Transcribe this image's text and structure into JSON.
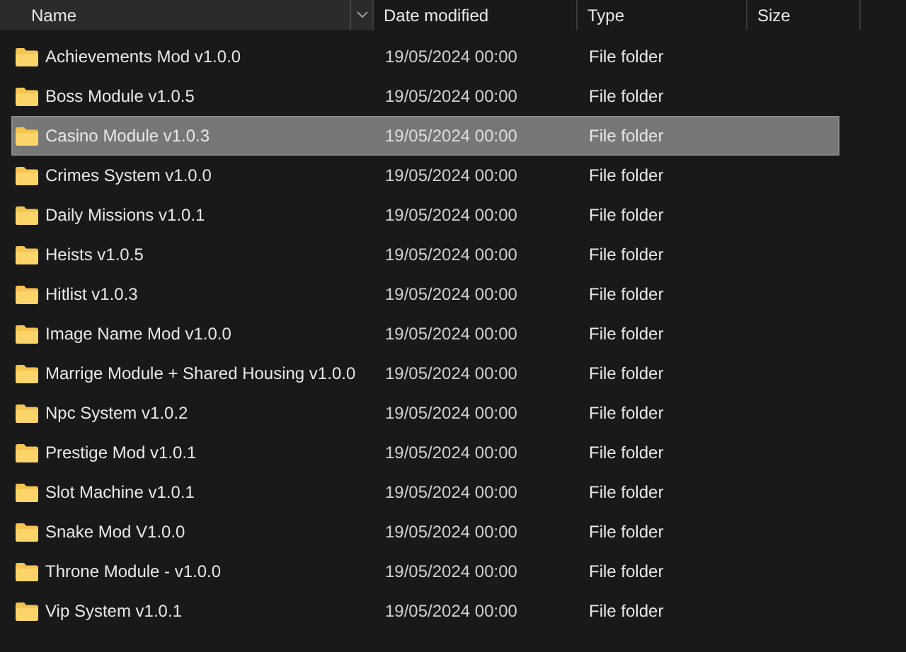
{
  "columns": [
    {
      "label": "Name",
      "sort_menu": true
    },
    {
      "label": "Date modified"
    },
    {
      "label": "Type"
    },
    {
      "label": "Size"
    }
  ],
  "rows": [
    {
      "name": "Achievements Mod v1.0.0",
      "date": "19/05/2024 00:00",
      "type": "File folder",
      "selected": false
    },
    {
      "name": "Boss Module v1.0.5",
      "date": "19/05/2024 00:00",
      "type": "File folder",
      "selected": false
    },
    {
      "name": "Casino Module v1.0.3",
      "date": "19/05/2024 00:00",
      "type": "File folder",
      "selected": true
    },
    {
      "name": "Crimes System v1.0.0",
      "date": "19/05/2024 00:00",
      "type": "File folder",
      "selected": false
    },
    {
      "name": "Daily Missions v1.0.1",
      "date": "19/05/2024 00:00",
      "type": "File folder",
      "selected": false
    },
    {
      "name": "Heists v1.0.5",
      "date": "19/05/2024 00:00",
      "type": "File folder",
      "selected": false
    },
    {
      "name": "Hitlist v1.0.3",
      "date": "19/05/2024 00:00",
      "type": "File folder",
      "selected": false
    },
    {
      "name": "Image Name Mod v1.0.0",
      "date": "19/05/2024 00:00",
      "type": "File folder",
      "selected": false
    },
    {
      "name": "Marrige Module + Shared Housing v1.0.0",
      "date": "19/05/2024 00:00",
      "type": "File folder",
      "selected": false
    },
    {
      "name": "Npc System v1.0.2",
      "date": "19/05/2024 00:00",
      "type": "File folder",
      "selected": false
    },
    {
      "name": "Prestige Mod v1.0.1",
      "date": "19/05/2024 00:00",
      "type": "File folder",
      "selected": false
    },
    {
      "name": "Slot Machine v1.0.1",
      "date": "19/05/2024 00:00",
      "type": "File folder",
      "selected": false
    },
    {
      "name": "Snake Mod V1.0.0",
      "date": "19/05/2024 00:00",
      "type": "File folder",
      "selected": false
    },
    {
      "name": "Throne Module - v1.0.0",
      "date": "19/05/2024 00:00",
      "type": "File folder",
      "selected": false
    },
    {
      "name": "Vip System v1.0.1",
      "date": "19/05/2024 00:00",
      "type": "File folder",
      "selected": false
    }
  ]
}
